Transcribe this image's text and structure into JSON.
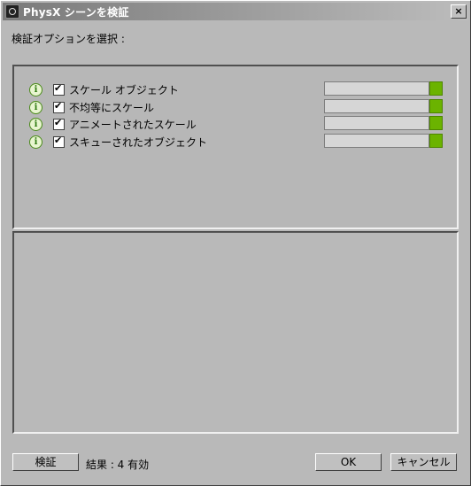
{
  "window": {
    "title": "PhysX シーンを検証",
    "close_glyph": "×"
  },
  "prompt": "検証オプションを選択 :",
  "checks": [
    {
      "label": "スケール オブジェクト",
      "checked": true
    },
    {
      "label": "不均等にスケール",
      "checked": true
    },
    {
      "label": "アニメートされたスケール",
      "checked": true
    },
    {
      "label": "スキューされたオブジェクト",
      "checked": true
    }
  ],
  "info_glyph": "i",
  "colors": {
    "status_ok": "#6bb300",
    "info": "#2f7a12"
  },
  "footer": {
    "validate_button": "検証",
    "result_text": "結果 : 4 有効",
    "ok_button": "OK",
    "cancel_button": "キャンセル"
  }
}
